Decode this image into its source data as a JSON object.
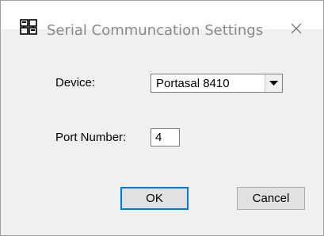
{
  "window": {
    "title": "Serial Communcation Settings",
    "close_icon": "close-icon",
    "app_icon": "serial-app-icon"
  },
  "form": {
    "device_label": "Device:",
    "device_value": "Portasal 8410",
    "port_label": "Port Number:",
    "port_value": "4"
  },
  "buttons": {
    "ok_label": "OK",
    "cancel_label": "Cancel"
  },
  "colors": {
    "default_button_border": "#0078d7",
    "title_text": "#8a8a8a",
    "window_bg": "#f0f0f0"
  }
}
